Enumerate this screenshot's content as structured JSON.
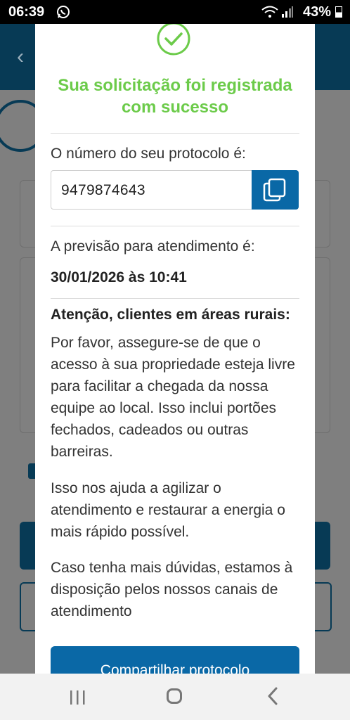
{
  "status_bar": {
    "time": "06:39",
    "battery": "43%",
    "battery_level": 0.43
  },
  "dialog": {
    "title": "Sua solicitação foi registrada com sucesso",
    "protocol_label": "O número do seu protocolo é:",
    "protocol_number": "9479874643",
    "forecast_label": "A previsão para atendimento é:",
    "forecast_value": "30/01/2026 às 10:41",
    "attention_title": "Atenção, clientes em áreas rurais:",
    "paragraph_1": "Por favor, assegure-se de que o acesso à sua propriedade esteja livre para facilitar a chegada da nossa equipe ao local. Isso inclui portões fechados, cadeados ou outras barreiras.",
    "paragraph_2": "Isso nos ajuda a agilizar o atendimento e restaurar a energia o mais rápido possível.",
    "paragraph_3": "Caso tenha mais dúvidas, estamos à disposição pelos nossos canais de atendimento",
    "share_button": "Compartilhar protocolo"
  },
  "colors": {
    "success": "#6ccb4a",
    "primary": "#0a68a6",
    "header": "#073a55"
  },
  "icons": [
    "whatsapp-icon",
    "wifi-icon",
    "signal-icon",
    "battery-icon",
    "check-circle-icon",
    "copy-icon",
    "recent-apps-icon",
    "home-icon",
    "back-icon"
  ]
}
